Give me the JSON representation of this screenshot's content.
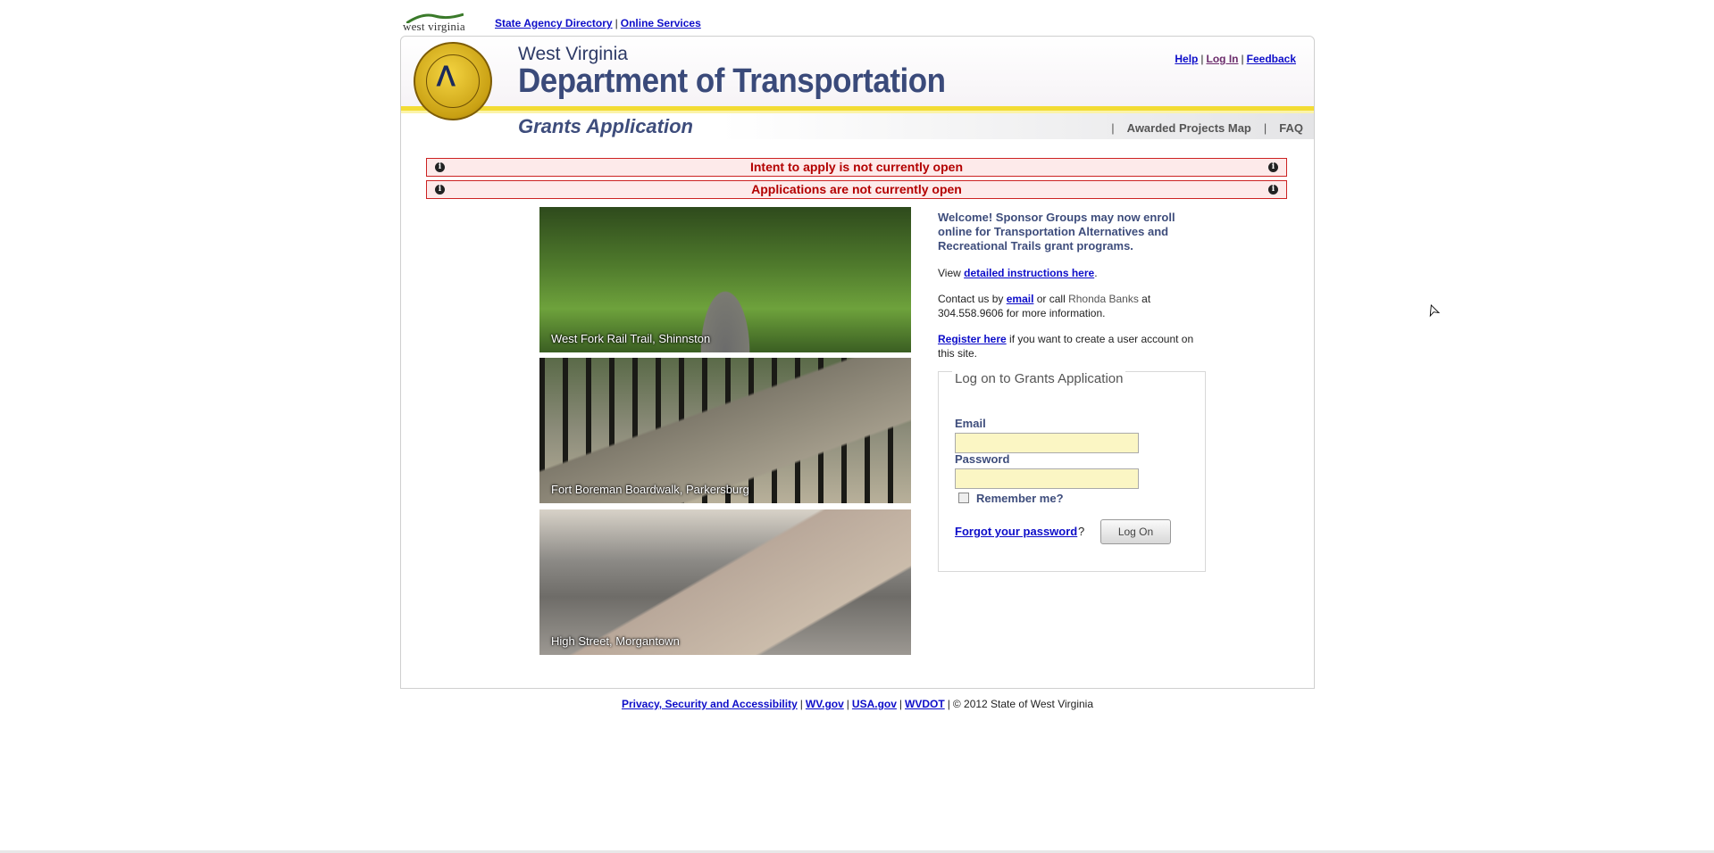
{
  "topbar": {
    "logo_text": "west virginia",
    "links": [
      "State Agency Directory",
      "Online Services"
    ]
  },
  "header": {
    "org_sub": "West Virginia",
    "org_title": "Department of Transportation",
    "app_title": "Grants Application",
    "util_links": {
      "help": "Help",
      "login": "Log In",
      "feedback": "Feedback"
    },
    "subnav": [
      "Awarded Projects Map",
      "FAQ"
    ]
  },
  "alerts": [
    "Intent to apply is not currently open",
    "Applications are not currently open"
  ],
  "photos": [
    {
      "caption": "West Fork Rail Trail, Shinnston"
    },
    {
      "caption": "Fort Boreman Boardwalk, Parkersburg"
    },
    {
      "caption": "High Street, Morgantown"
    }
  ],
  "main": {
    "welcome": "Welcome! Sponsor Groups may now enroll online for Transportation Alternatives and Recreational Trails grant programs.",
    "view_prefix": "View ",
    "view_link": "detailed instructions here",
    "view_suffix": ".",
    "contact_prefix": "Contact us by ",
    "contact_link": "email",
    "contact_mid": " or call ",
    "contact_name": "Rhonda Banks",
    "contact_suffix": " at 304.558.9606 for more information.",
    "register_link": "Register here",
    "register_suffix": " if you want to create a user account on this site."
  },
  "login": {
    "legend": "Log on to Grants Application",
    "email_label": "Email",
    "email_value": "",
    "password_label": "Password",
    "password_value": "",
    "remember_label": "Remember me?",
    "remember_checked": false,
    "forgot_link": "Forgot your password",
    "forgot_suffix": "?",
    "submit_label": "Log On"
  },
  "footer": {
    "links": [
      "Privacy, Security and Accessibility",
      "WV.gov",
      "USA.gov",
      "WVDOT"
    ],
    "copyright": "© 2012 State of West Virginia"
  },
  "colors": {
    "accent_yellow": "#f3dc34",
    "title_navy": "#3e4d7c",
    "alert_red": "#b30000",
    "link_blue": "#0d0dc9",
    "input_bg": "#fbf6c4"
  }
}
